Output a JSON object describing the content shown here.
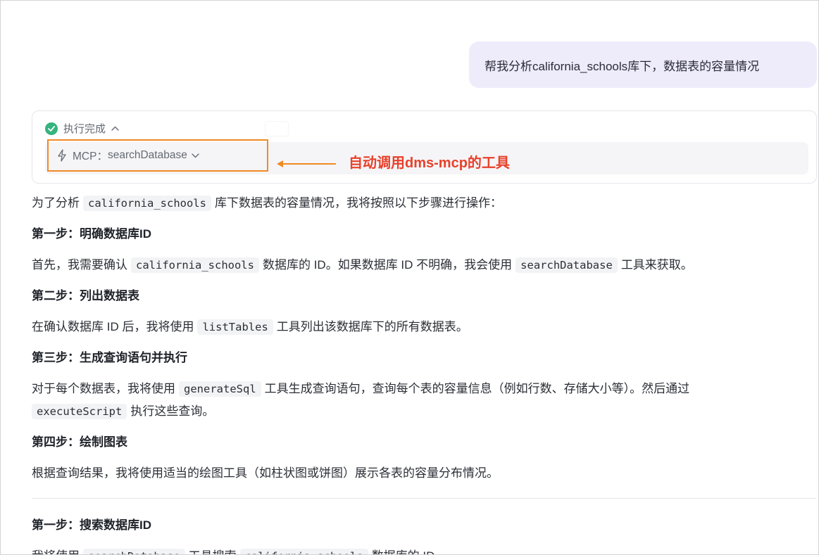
{
  "user_message": "帮我分析california_schools库下，数据表的容量情况",
  "exec": {
    "status": "执行完成",
    "tool_prefix": "MCP：",
    "tool_name": "searchDatabase"
  },
  "annotation": "自动调用dms-mcp的工具",
  "colors": {
    "accent_orange": "#f08a24",
    "annotation_red": "#e8412b",
    "success_green": "#36b37e",
    "bubble_bg": "#eeecfb"
  },
  "content": {
    "intro": {
      "a": "为了分析",
      "code": "california_schools",
      "b": "库下数据表的容量情况，我将按照以下步骤进行操作："
    },
    "step1_title": "第一步：明确数据库ID",
    "step1": {
      "a": "首先，我需要确认",
      "code1": "california_schools",
      "b": "数据库的 ID。如果数据库 ID 不明确，我会使用",
      "code2": "searchDatabase",
      "c": "工具来获取。"
    },
    "step2_title": "第二步：列出数据表",
    "step2": {
      "a": "在确认数据库 ID 后，我将使用",
      "code": "listTables",
      "b": "工具列出该数据库下的所有数据表。"
    },
    "step3_title": "第三步：生成查询语句并执行",
    "step3": {
      "a": "对于每个数据表，我将使用",
      "code1": "generateSql",
      "b": "工具生成查询语句，查询每个表的容量信息（例如行数、存储大小等）。然后通过",
      "code2": "executeScript",
      "c": "执行这些查询。"
    },
    "step4_title": "第四步：绘制图表",
    "step4": "根据查询结果，我将使用适当的绘图工具（如柱状图或饼图）展示各表的容量分布情况。",
    "section2_title": "第一步：搜索数据库ID",
    "section2_cut": {
      "a": "我将使用",
      "code1": "searchDatabase",
      "b": "工具搜索",
      "code2": "california_schools",
      "c": "数据库的 ID。"
    }
  }
}
